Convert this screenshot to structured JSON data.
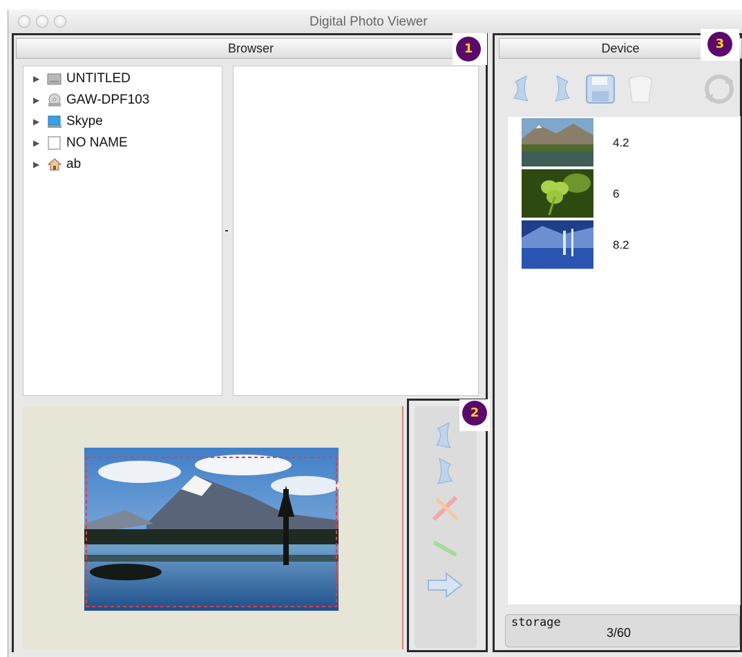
{
  "window": {
    "title": "Digital Photo Viewer"
  },
  "browser": {
    "header": "Browser",
    "tree": [
      {
        "label": "UNTITLED",
        "icon": "hard-drive-icon"
      },
      {
        "label": "GAW-DPF103",
        "icon": "optical-drive-icon"
      },
      {
        "label": "Skype",
        "icon": "skype-drive-icon"
      },
      {
        "label": "NO NAME",
        "icon": "removable-drive-icon"
      },
      {
        "label": "ab",
        "icon": "home-folder-icon"
      }
    ]
  },
  "device": {
    "header": "Device",
    "toolbar": [
      "rotate-left-icon",
      "rotate-right-icon",
      "save-icon",
      "trash-icon",
      "refresh-icon"
    ],
    "photos": [
      {
        "value": "4.2"
      },
      {
        "value": "6"
      },
      {
        "value": "8.2"
      }
    ],
    "storage_label": "storage",
    "storage_value": "3/60"
  },
  "callouts": [
    "1",
    "2",
    "3"
  ],
  "side_toolbar": [
    "rotate-left-icon",
    "rotate-right-icon",
    "crop-icon",
    "pencil-icon",
    "transfer-arrow-icon"
  ]
}
